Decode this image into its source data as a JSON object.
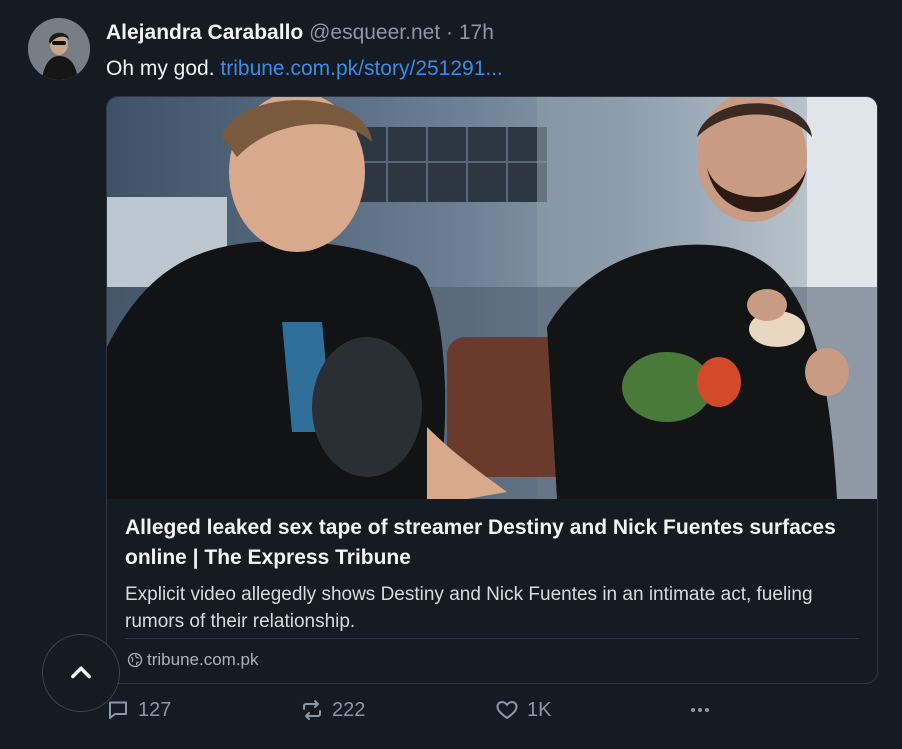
{
  "post": {
    "author_name": "Alejandra Caraballo",
    "author_handle": "@esqueer.net",
    "separator": "·",
    "time": "17h",
    "text": "Oh my god.",
    "link_text": "tribune.com.pk/story/251291..."
  },
  "card": {
    "title": "Alleged leaked sex tape of streamer Destiny and Nick Fuentes surfaces online | The Express Tribune",
    "description": "Explicit video allegedly shows Destiny and Nick Fuentes in an intimate act, fueling rumors of their relationship.",
    "source": "tribune.com.pk"
  },
  "actions": {
    "reply_count": "127",
    "repost_count": "222",
    "like_count": "1K"
  },
  "icons": {
    "reply": "reply-icon",
    "repost": "repost-icon",
    "like": "heart-icon",
    "more": "more-icon",
    "scroll_top": "chevron-up-icon",
    "globe": "globe-icon"
  },
  "colors": {
    "background": "#151b23",
    "link": "#3b8ce8",
    "muted": "#8b98a5"
  }
}
